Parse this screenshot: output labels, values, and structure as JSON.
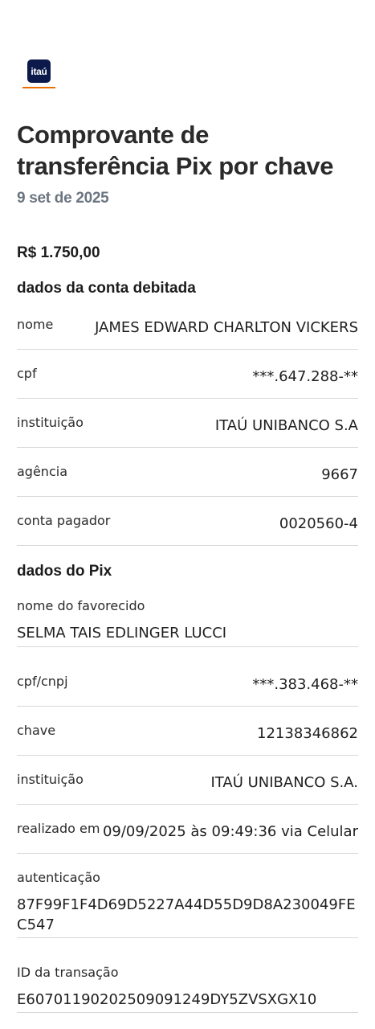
{
  "brand": {
    "logo_text": "itaú"
  },
  "header": {
    "title": "Comprovante de transferência Pix por chave",
    "date": "9 set de 2025"
  },
  "amount": "R$ 1.750,00",
  "debit_section": {
    "title": "dados da conta debitada",
    "rows": [
      {
        "label": "nome",
        "value": "JAMES EDWARD CHARLTON VICKERS"
      },
      {
        "label": "cpf",
        "value": "***.647.288-**"
      },
      {
        "label": "instituição",
        "value": "ITAÚ UNIBANCO S.A"
      },
      {
        "label": "agência",
        "value": "9667"
      },
      {
        "label": "conta pagador",
        "value": "0020560-4"
      }
    ]
  },
  "pix_section": {
    "title": "dados do Pix",
    "payee_label": "nome do favorecido",
    "payee_value": "SELMA TAIS EDLINGER LUCCI",
    "rows": [
      {
        "label": "cpf/cnpj",
        "value": "***.383.468-**"
      },
      {
        "label": "chave",
        "value": "12138346862"
      },
      {
        "label": "instituição",
        "value": "ITAÚ UNIBANCO S.A."
      },
      {
        "label": "realizado em",
        "value": "09/09/2025 às 09:49:36 via Celular"
      }
    ],
    "auth_label": "autenticação",
    "auth_value": "87F99F1F4D69D5227A44D55D9D8A230049FEC547",
    "txid_label": "ID da transação",
    "txid_value": "E60701190202509091249DY5ZVSXGX10"
  },
  "colors": {
    "brand_blue": "#0c1a4b",
    "brand_orange": "#ec7000",
    "muted_gray": "#6b7580"
  }
}
